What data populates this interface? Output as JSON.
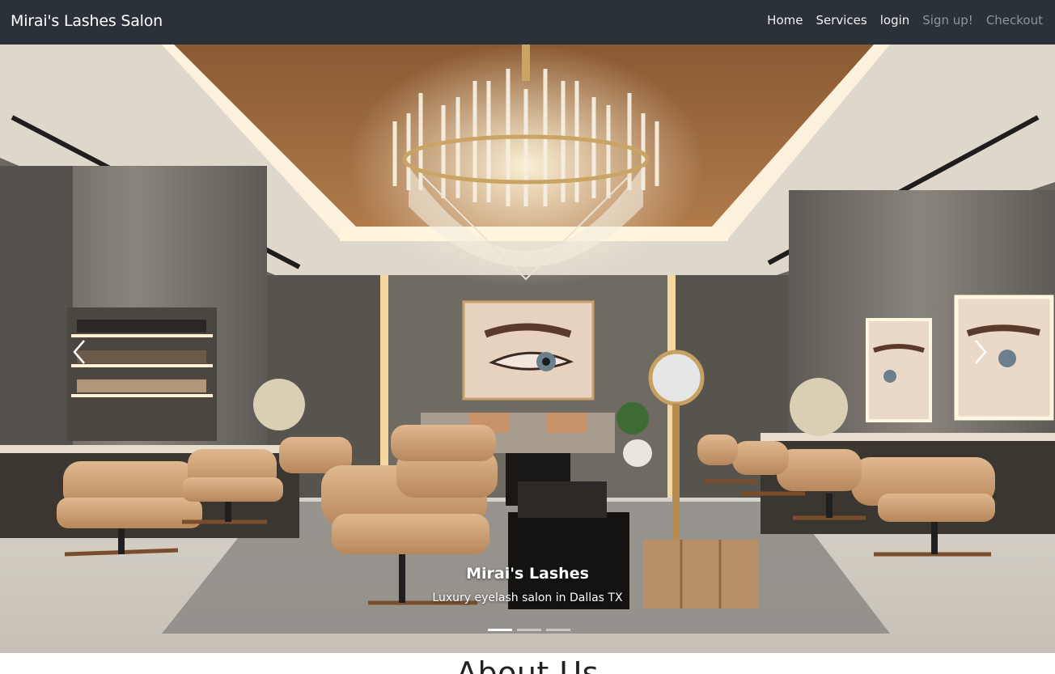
{
  "navbar": {
    "brand": "Mirai's Lashes Salon",
    "links": [
      "Home",
      "Services",
      "login",
      "Sign up!",
      "Checkout"
    ]
  },
  "carousel": {
    "caption_title": "Mirai's Lashes",
    "caption_text": "Luxury eyelash salon in Dallas TX",
    "slides": 3,
    "active_slide": 1
  },
  "about": {
    "heading": "About Us"
  }
}
